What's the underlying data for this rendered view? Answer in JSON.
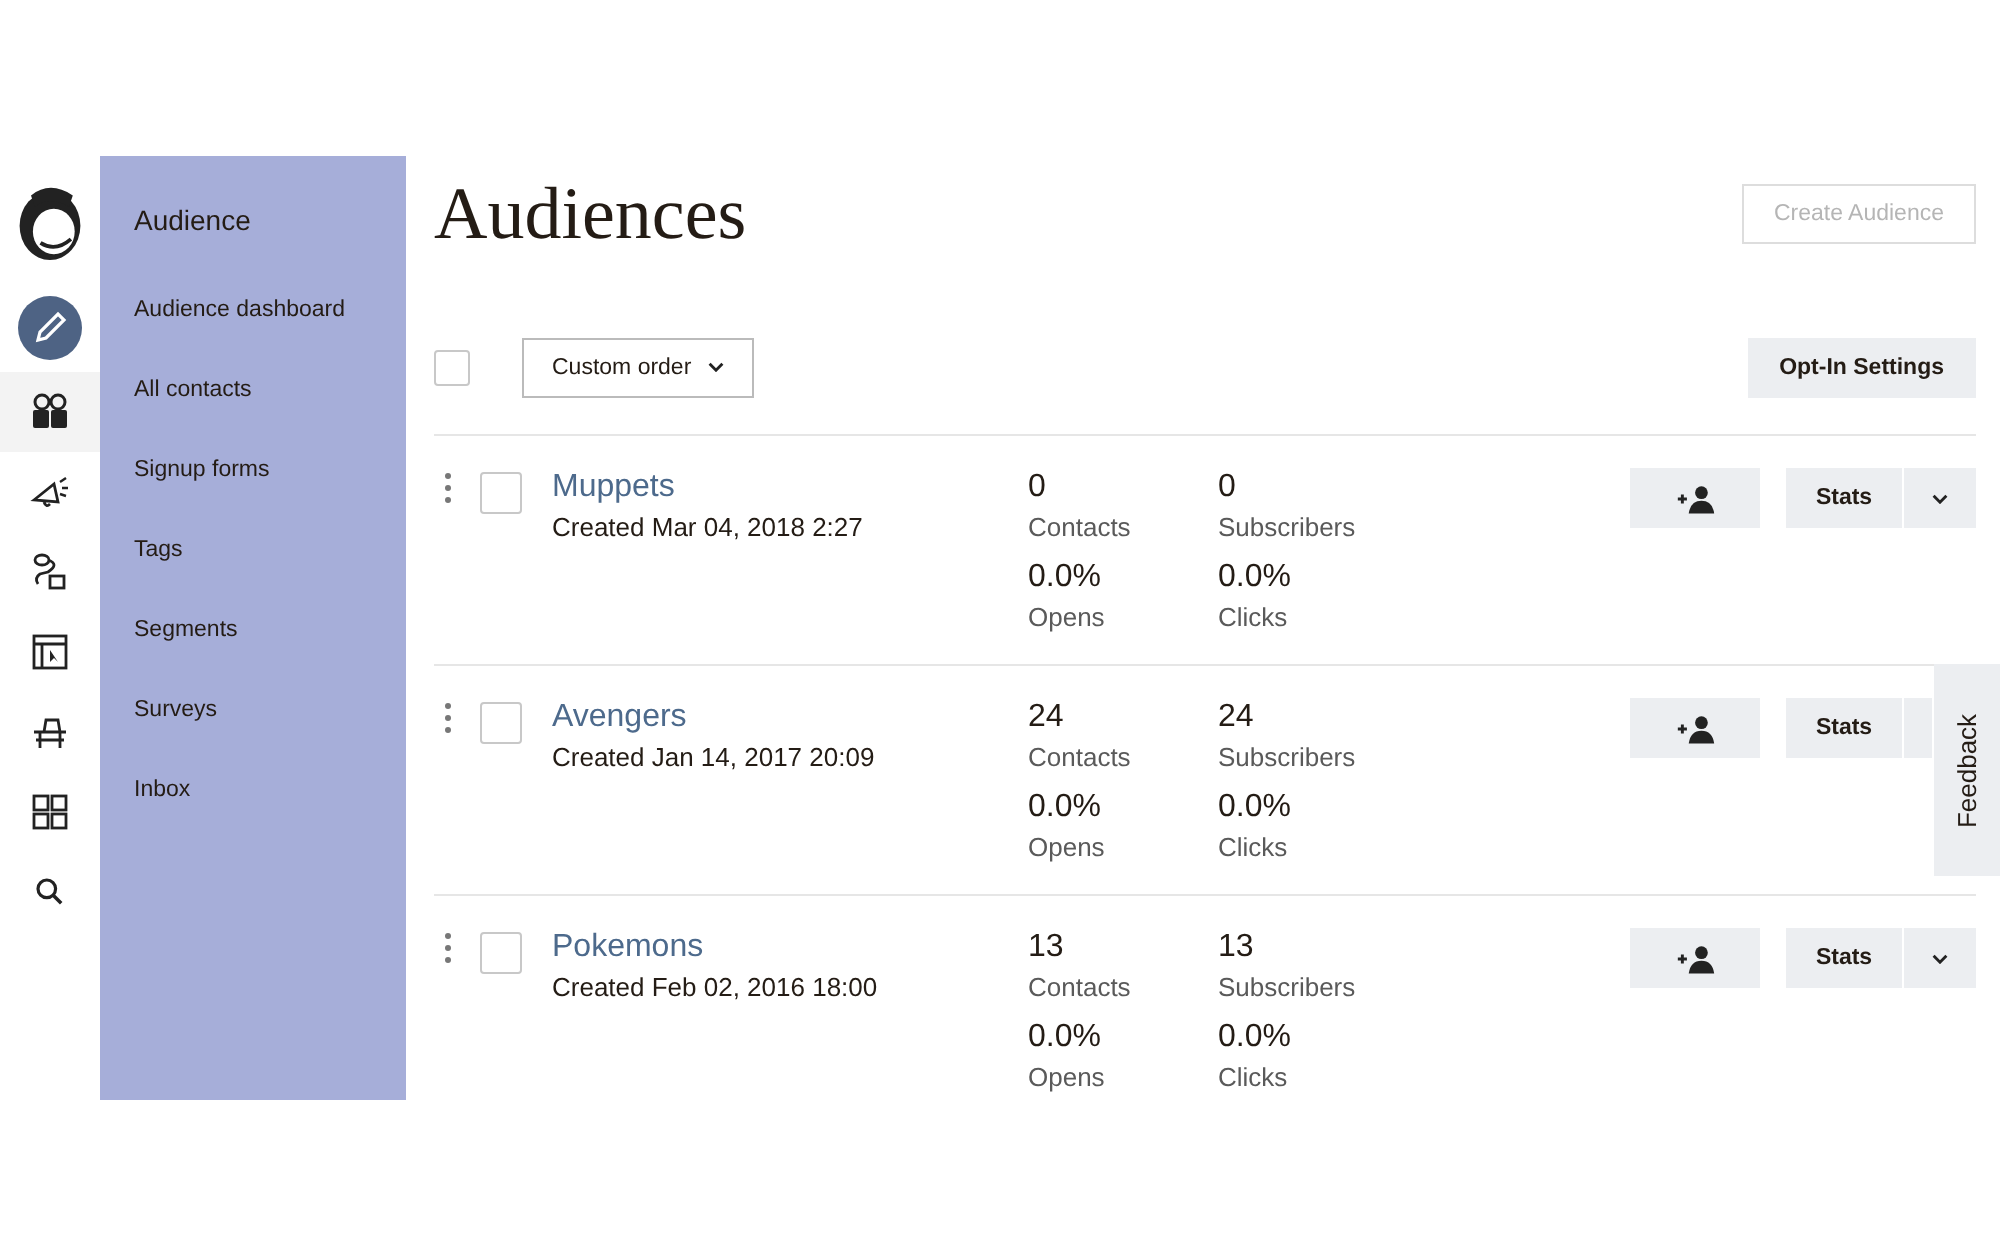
{
  "rail": {
    "items": [
      {
        "selected": false
      },
      {
        "selected": true
      },
      {
        "selected": false
      },
      {
        "selected": false
      },
      {
        "selected": false
      },
      {
        "selected": false
      },
      {
        "selected": false
      },
      {
        "selected": false
      }
    ]
  },
  "panel": {
    "title": "Audience",
    "items": [
      "Audience dashboard",
      "All contacts",
      "Signup forms",
      "Tags",
      "Segments",
      "Surveys",
      "Inbox"
    ]
  },
  "header": {
    "title": "Audiences",
    "create_button": {
      "label": "Create Audience",
      "disabled": true
    }
  },
  "toolbar": {
    "select_all_checked": false,
    "sort": "Custom order",
    "opt_in_button": "Opt-In Settings"
  },
  "rows": [
    {
      "name": "Muppets",
      "created": "Created Mar 04, 2018 2:27",
      "checked": false,
      "contacts": "0",
      "contacts_label": "Contacts",
      "subscribers": "0",
      "subscribers_label": "Subscribers",
      "opens": "0.0%",
      "opens_label": "Opens",
      "clicks": "0.0%",
      "clicks_label": "Clicks",
      "stats_button": "Stats",
      "menu_caret": true
    },
    {
      "name": "Avengers",
      "created": "Created Jan 14, 2017 20:09",
      "checked": false,
      "contacts": "24",
      "contacts_label": "Contacts",
      "subscribers": "24",
      "subscribers_label": "Subscribers",
      "opens": "0.0%",
      "opens_label": "Opens",
      "clicks": "0.0%",
      "clicks_label": "Clicks",
      "stats_button": "Stats",
      "menu_caret": false
    },
    {
      "name": "Pokemons",
      "created": "Created Feb 02, 2016 18:00",
      "checked": false,
      "contacts": "13",
      "contacts_label": "Contacts",
      "subscribers": "13",
      "subscribers_label": "Subscribers",
      "opens": "0.0%",
      "opens_label": "Opens",
      "clicks": "0.0%",
      "clicks_label": "Clicks",
      "stats_button": "Stats",
      "menu_caret": true
    }
  ],
  "feedback_tab": "Feedback"
}
